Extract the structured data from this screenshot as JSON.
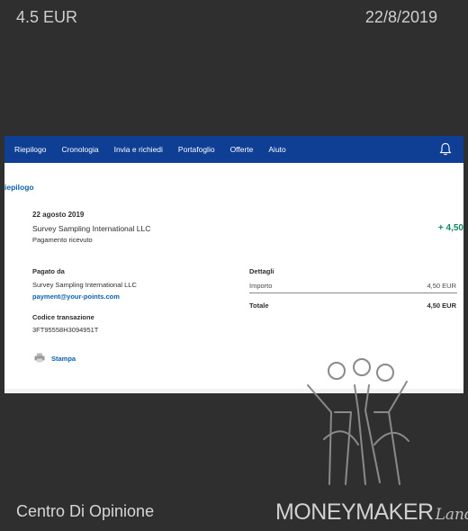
{
  "frame": {
    "amount": "4.5 EUR",
    "date": "22/8/2019",
    "company": "Centro Di Opinione",
    "brand": {
      "money_maker": "MONEYMAKER",
      "land": "Land"
    }
  },
  "navbar": {
    "items": [
      "Riepilogo",
      "Cronologia",
      "Invia e richiedi",
      "Portafoglio",
      "Offerte",
      "Aiuto"
    ],
    "bg_color": "#0f3e95"
  },
  "summary": {
    "title": "iepilogo"
  },
  "transaction": {
    "date": "22 agosto 2019",
    "merchant": "Survey Sampling International LLC",
    "status": "Pagamento ricevuto",
    "amount": "+ 4,50",
    "amount_color": "#138a5e"
  },
  "payer": {
    "label": "Pagato da",
    "name": "Survey Sampling International LLC",
    "email": "payment@your-points.com"
  },
  "transaction_code": {
    "label": "Codice transazione",
    "value": "3FT95558H3094951T"
  },
  "details": {
    "title": "Dettagli",
    "importo_label": "Importo",
    "importo_value": "4,50 EUR",
    "totale_label": "Totale",
    "totale_value": "4,50 EUR"
  },
  "print": {
    "label": "Stampa",
    "icon": "printer-icon"
  }
}
